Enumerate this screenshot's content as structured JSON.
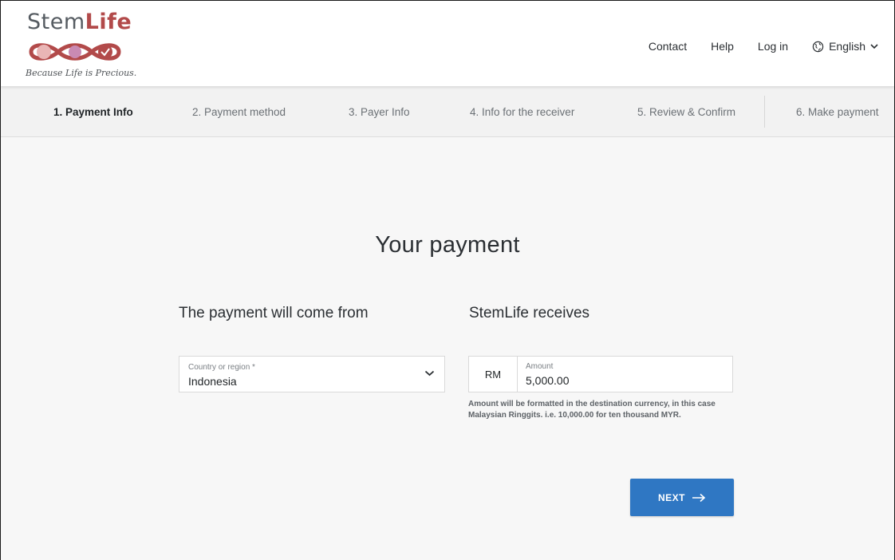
{
  "brand": {
    "name_regular": "Stem",
    "name_bold": "Life",
    "tagline": "Because Life is Precious.",
    "colors": {
      "primary": "#b24a4a",
      "light": "#e9b6b6",
      "accent": "#c98ab3"
    }
  },
  "topnav": {
    "contact": "Contact",
    "help": "Help",
    "login": "Log in",
    "language": "English",
    "language_icon": "globe-icon"
  },
  "steps": [
    {
      "label": "1. Payment Info",
      "active": true
    },
    {
      "label": "2. Payment method",
      "active": false
    },
    {
      "label": "3. Payer Info",
      "active": false
    },
    {
      "label": "4. Info for the receiver",
      "active": false
    },
    {
      "label": "5. Review & Confirm",
      "active": false
    },
    {
      "label": "6. Make payment",
      "active": false
    }
  ],
  "main": {
    "title": "Your payment",
    "from": {
      "heading": "The payment will come from",
      "country_label": "Country or region *",
      "country_value": "Indonesia"
    },
    "to": {
      "heading": "StemLife receives",
      "currency": "RM",
      "amount_label": "Amount",
      "amount_value": "5,000.00",
      "helper": "Amount will be formatted in the destination currency, in this case Malaysian Ringgits. i.e. 10,000.00 for ten thousand MYR."
    },
    "next_label": "NEXT",
    "accent_color": "#2f77c3"
  }
}
